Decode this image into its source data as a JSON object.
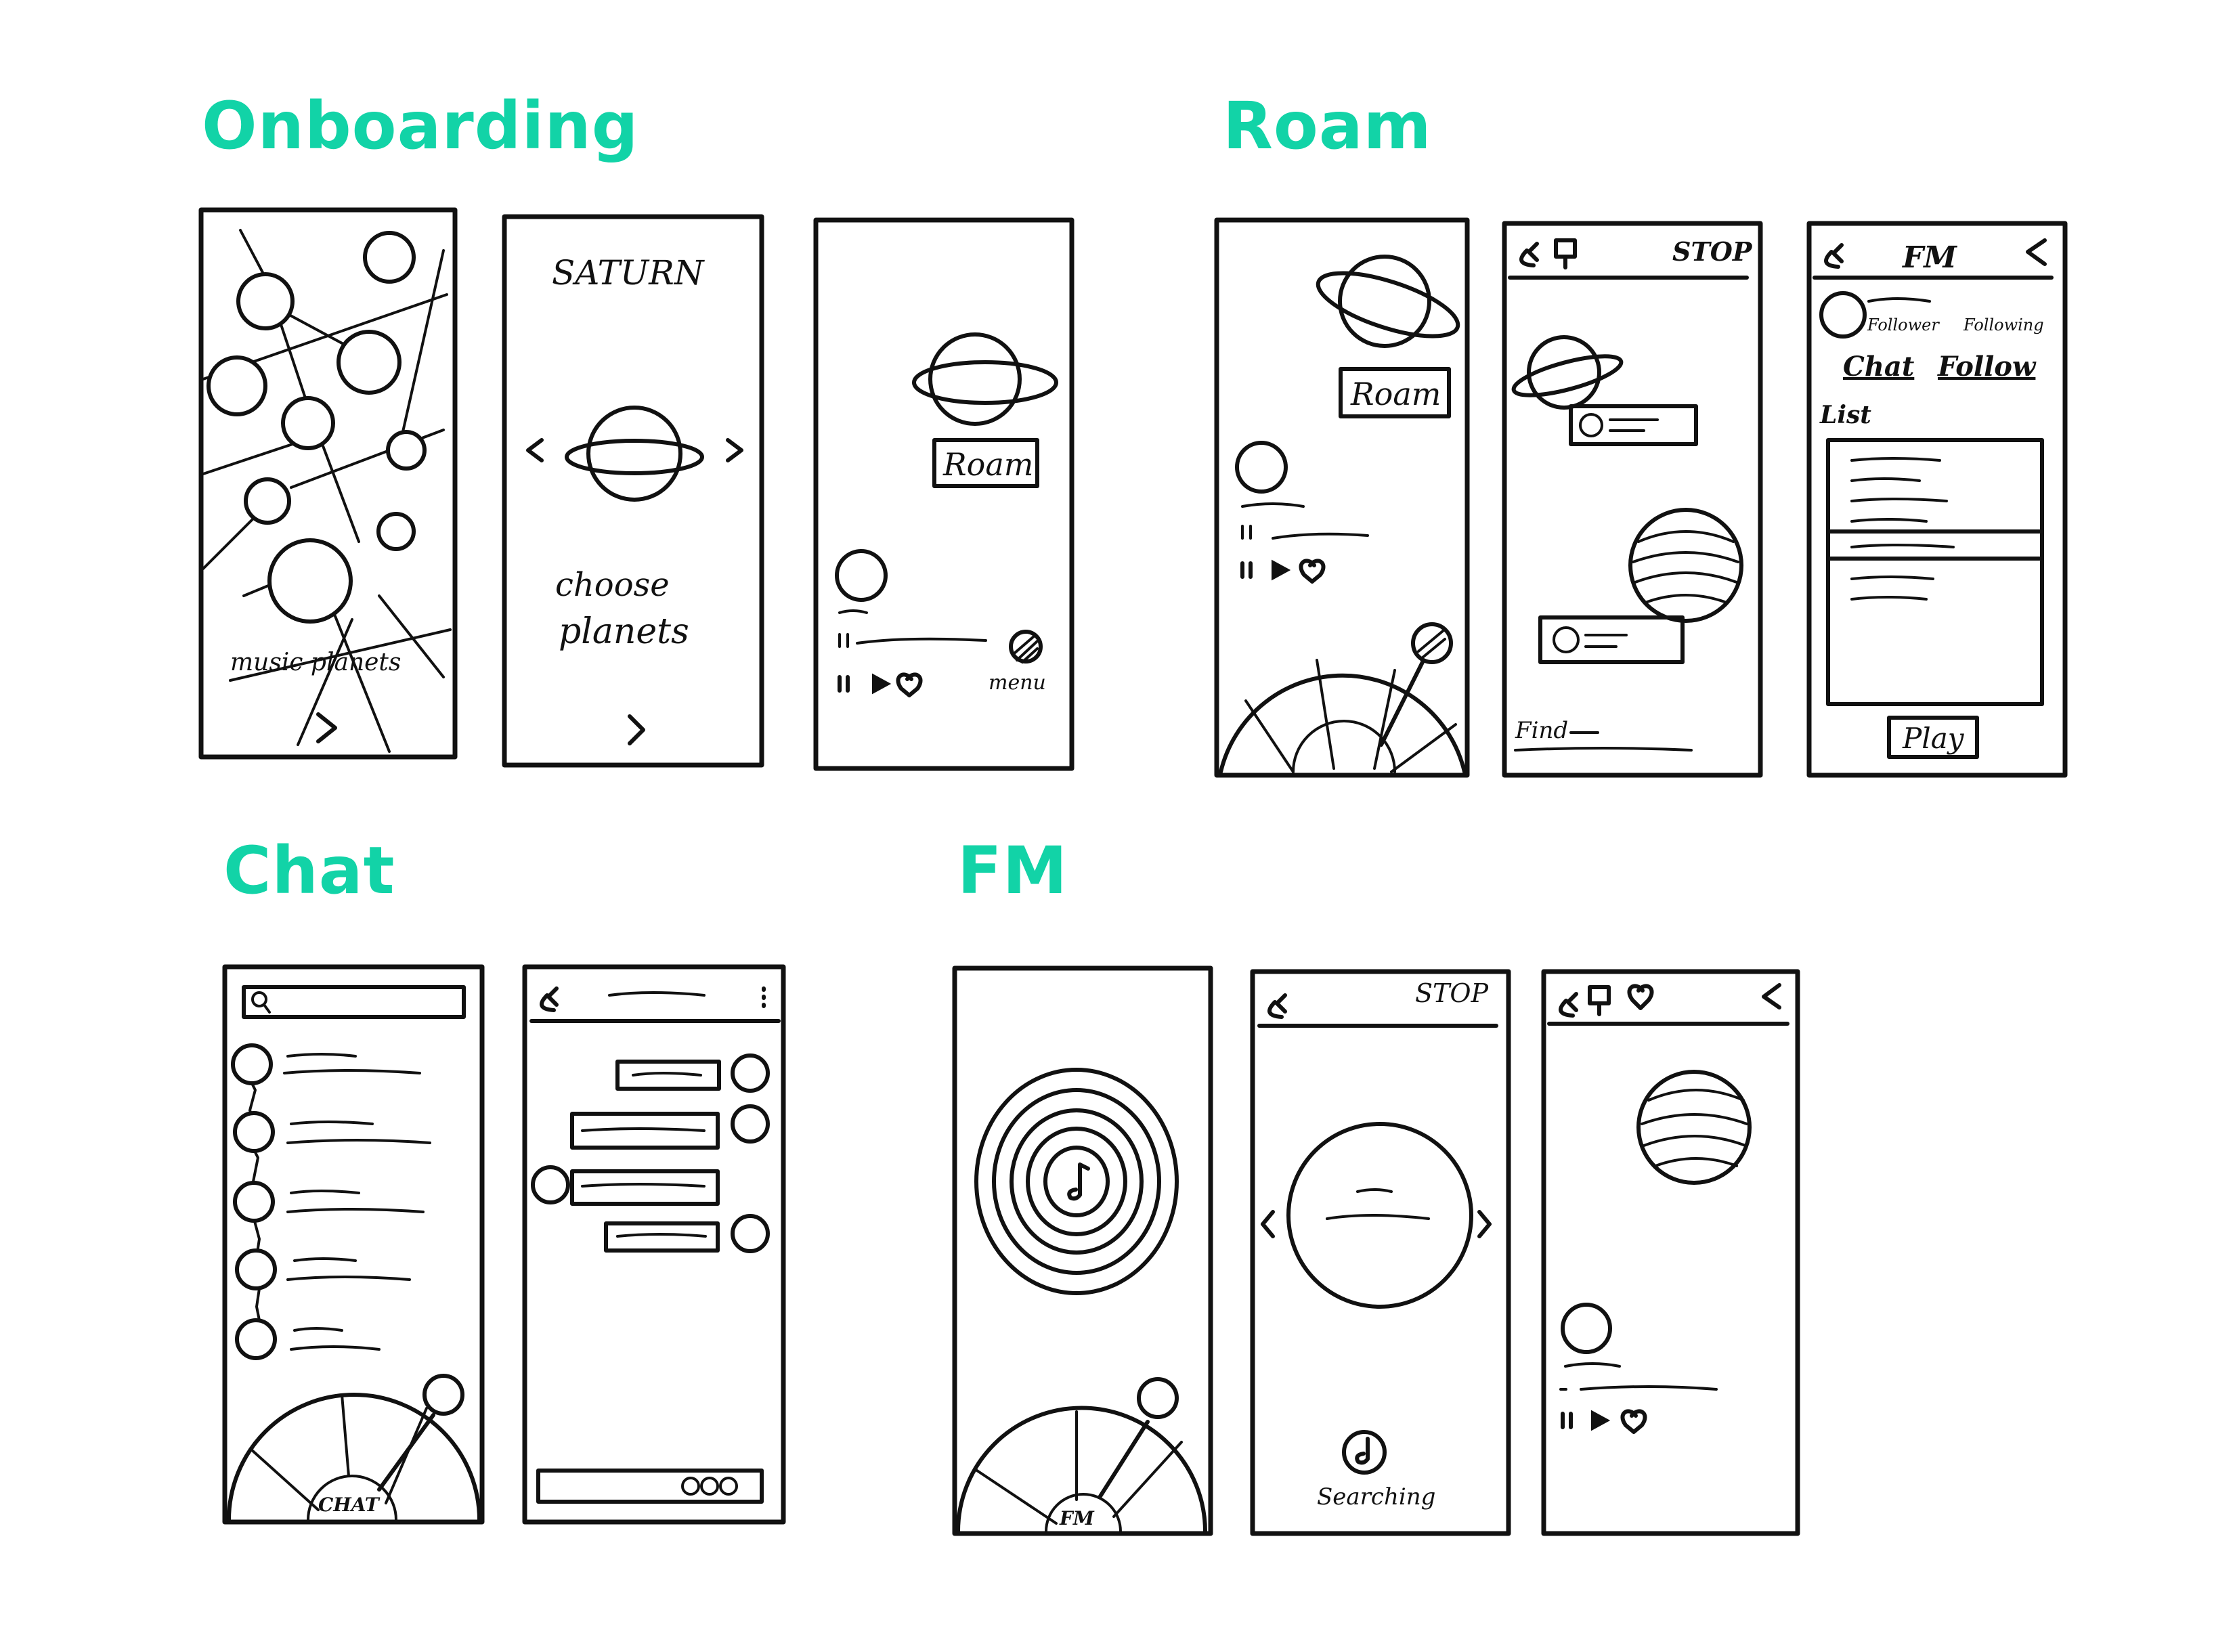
{
  "colors": {
    "accent": "#12d3a7",
    "ink": "#111111"
  },
  "sections": {
    "onboarding": "Onboarding",
    "roam": "Roam",
    "chat": "Chat",
    "fm": "FM"
  },
  "onboarding": {
    "screen1_label": "music planets",
    "screen2_title": "SATURN",
    "screen2_caption_1": "choose",
    "screen2_caption_2": "planets",
    "screen3_button": "Roam",
    "screen3_menu": "menu"
  },
  "roam": {
    "screen1_button": "Roam",
    "screen2_stop": "STOP",
    "screen2_find": "Find",
    "screen3_title": "FM",
    "screen3_follower": "Follower",
    "screen3_following": "Following",
    "screen3_chat": "Chat",
    "screen3_follow": "Follow",
    "screen3_list": "List",
    "screen3_play": "Play"
  },
  "chat": {
    "wheel_label": "CHAT"
  },
  "fm": {
    "wheel_label": "FM",
    "screen2_stop": "STOP",
    "screen2_status": "Searching"
  }
}
